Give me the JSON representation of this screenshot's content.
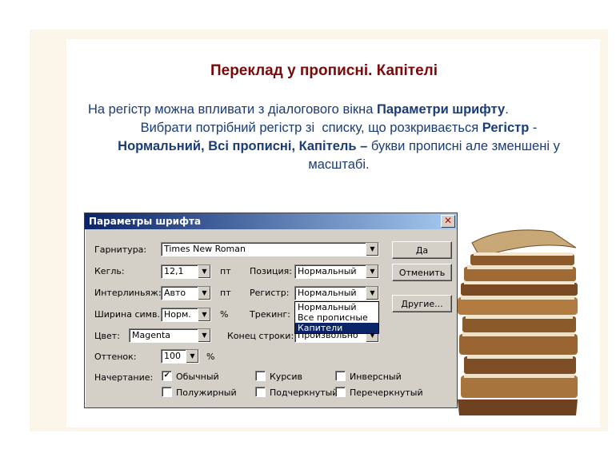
{
  "slide": {
    "title": "Переклад у прописні. Капітелі",
    "text_part1": "На регістр можна впливати з діалогового вікна ",
    "text_bold1": "Параметри шрифту",
    "text_part2": ". Вибрати потрібний регістр зі  списку, що розкривається ",
    "text_bold2": "Регістр",
    "text_part3": " - ",
    "text_bold3": "Нормальний, Всі прописні, Капітель –",
    "text_part4": " букви прописні але зменшені у масштабі."
  },
  "dialog": {
    "title": "Параметры шрифта",
    "close_glyph": "✕",
    "labels": {
      "font": "Гарнитура:",
      "size": "Кегль:",
      "leading": "Интерлиньяж:",
      "width": "Ширина симв.:",
      "color": "Цвет:",
      "shade": "Оттенок:",
      "style": "Начертание:",
      "position": "Позиция:",
      "case": "Регистр:",
      "tracking": "Трекинг:",
      "line_end": "Конец строки:"
    },
    "values": {
      "font": "Times New Roman",
      "size": "12,1",
      "leading": "Авто",
      "width": "Норм.",
      "color": "Magenta",
      "shade": "100",
      "position": "Нормальный",
      "case": "Нормальный",
      "line_end": "Произвольно"
    },
    "units": {
      "size": "пт",
      "leading": "пт",
      "width": "%",
      "shade": "%"
    },
    "case_options": [
      "Нормальный",
      "Все прописные",
      "Капители"
    ],
    "case_highlighted": "Капители",
    "buttons": {
      "ok": "Да",
      "cancel": "Отменить",
      "other": "Другие..."
    },
    "checkboxes": [
      {
        "label": "Обычный",
        "checked": true
      },
      {
        "label": "Курсив",
        "checked": false
      },
      {
        "label": "Инверсный",
        "checked": false
      },
      {
        "label": "Полужирный",
        "checked": false
      },
      {
        "label": "Подчеркнутый",
        "checked": false
      },
      {
        "label": "Перечеркнутый",
        "checked": false
      }
    ],
    "check_mark": "✔"
  },
  "colors": {
    "title": "#7a0a0a",
    "text": "#1a3c78",
    "frame": "#fbf5ea",
    "dialog_bg": "#d4d0c8",
    "titlebar": "#0a246a"
  }
}
